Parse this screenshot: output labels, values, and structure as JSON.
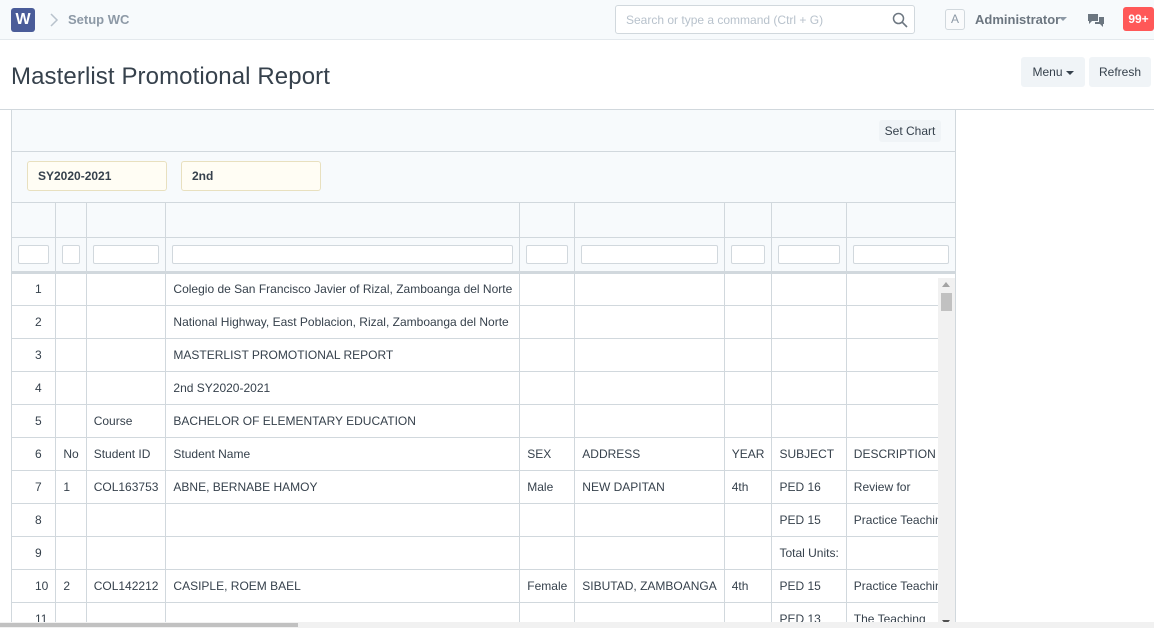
{
  "navbar": {
    "logo": "W",
    "breadcrumb": "Setup WC",
    "search_placeholder": "Search or type a command (Ctrl + G)",
    "avatar": "A",
    "user": "Administrator",
    "notifications": "99+"
  },
  "page": {
    "title": "Masterlist Promotional Report",
    "menu_label": "Menu",
    "refresh_label": "Refresh"
  },
  "report": {
    "set_chart_label": "Set Chart",
    "filters": {
      "school_year": "SY2020-2021",
      "semester": "2nd"
    },
    "rows": [
      [
        "1",
        "",
        "",
        "Colegio de San Francisco Javier of Rizal, Zamboanga del Norte",
        "",
        "",
        "",
        "",
        ""
      ],
      [
        "2",
        "",
        "",
        "National Highway, East Poblacion, Rizal, Zamboanga del Norte",
        "",
        "",
        "",
        "",
        ""
      ],
      [
        "3",
        "",
        "",
        "MASTERLIST PROMOTIONAL REPORT",
        "",
        "",
        "",
        "",
        ""
      ],
      [
        "4",
        "",
        "",
        "2nd SY2020-2021",
        "",
        "",
        "",
        "",
        ""
      ],
      [
        "5",
        "",
        "Course",
        "BACHELOR OF ELEMENTARY EDUCATION",
        "",
        "",
        "",
        "",
        ""
      ],
      [
        "6",
        "No",
        "Student ID",
        "Student Name",
        "SEX",
        "ADDRESS",
        "YEAR",
        "SUBJECT",
        "DESCRIPTION"
      ],
      [
        "7",
        "1",
        "COL163753",
        "ABNE, BERNABE HAMOY",
        "Male",
        "NEW DAPITAN",
        "4th",
        "PED 16",
        "Review for"
      ],
      [
        "8",
        "",
        "",
        "",
        "",
        "",
        "",
        "PED 15",
        "Practice Teaching"
      ],
      [
        "9",
        "",
        "",
        "",
        "",
        "",
        "",
        "Total Units:",
        ""
      ],
      [
        "10",
        "2",
        "COL142212",
        "CASIPLE, ROEM BAEL",
        "Female",
        "SIBUTAD, ZAMBOANGA",
        "4th",
        "PED 15",
        "Practice Teaching"
      ],
      [
        "11",
        "",
        "",
        "",
        "",
        "",
        "",
        "PED 13",
        "The Teaching"
      ]
    ]
  },
  "colors": {
    "accent": "#4a5c99",
    "badge": "#ff5858",
    "filter_bg": "#fffdf4"
  }
}
